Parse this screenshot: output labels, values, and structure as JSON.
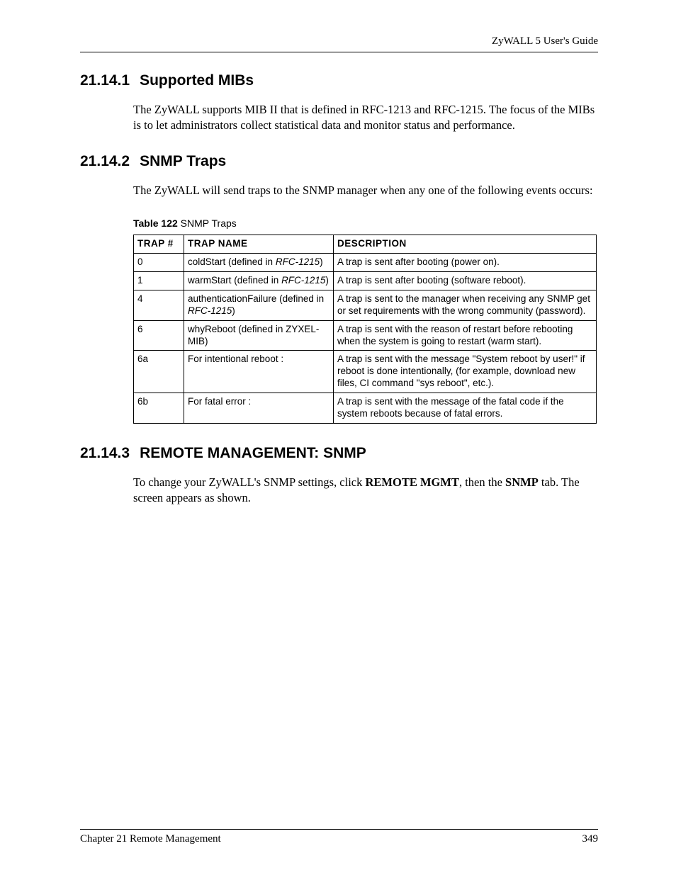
{
  "header": {
    "guide": "ZyWALL 5 User's Guide"
  },
  "sections": {
    "s1": {
      "num": "21.14.1",
      "title": "Supported MIBs",
      "body": "The ZyWALL supports MIB II that is defined in RFC-1213 and RFC-1215. The focus of the MIBs is to let administrators collect statistical data and monitor status and performance."
    },
    "s2": {
      "num": "21.14.2",
      "title": "SNMP Traps",
      "body": "The ZyWALL will send traps to the SNMP manager when any one of the following events occurs:"
    },
    "s3": {
      "num": "21.14.3",
      "title": "REMOTE MANAGEMENT: SNMP",
      "body_pre": "To change your ZyWALL's SNMP settings, click ",
      "body_b1": "REMOTE MGMT",
      "body_mid": ", then the ",
      "body_b2": "SNMP",
      "body_post": " tab. The screen appears as shown."
    }
  },
  "table": {
    "caption_bold": "Table 122",
    "caption_rest": "   SNMP Traps",
    "headers": {
      "h1": "TRAP #",
      "h2": "TRAP NAME",
      "h3": "DESCRIPTION"
    },
    "rows": [
      {
        "num": "0",
        "name_pre": "coldStart (defined in ",
        "name_it": "RFC-1215",
        "name_post": ")",
        "desc": "A trap is sent after booting (power on)."
      },
      {
        "num": "1",
        "name_pre": "warmStart (defined in ",
        "name_it": "RFC-1215",
        "name_post": ")",
        "desc": "A trap is sent after booting (software reboot)."
      },
      {
        "num": "4",
        "name_pre": "authenticationFailure (defined in ",
        "name_it": "RFC-1215",
        "name_post": ")",
        "desc": "A trap is sent to the manager when receiving any SNMP get or set requirements with the wrong community (password)."
      },
      {
        "num": "6",
        "name_pre": "whyReboot (defined in ZYXEL-MIB)",
        "name_it": "",
        "name_post": "",
        "desc": "A trap is sent with the reason of restart before rebooting when the system is going to restart (warm start)."
      },
      {
        "num": "6a",
        "name_pre": "For intentional reboot :",
        "name_it": "",
        "name_post": "",
        "desc": "A trap is sent with the message \"System reboot by user!\" if reboot is done intentionally, (for example, download new files, CI command \"sys reboot\", etc.)."
      },
      {
        "num": "6b",
        "name_pre": "For fatal error :",
        "name_it": "",
        "name_post": "",
        "desc": "A trap is sent with the message of the fatal code if the system reboots because of fatal errors."
      }
    ]
  },
  "footer": {
    "chapter": "Chapter 21 Remote Management",
    "page": "349"
  }
}
